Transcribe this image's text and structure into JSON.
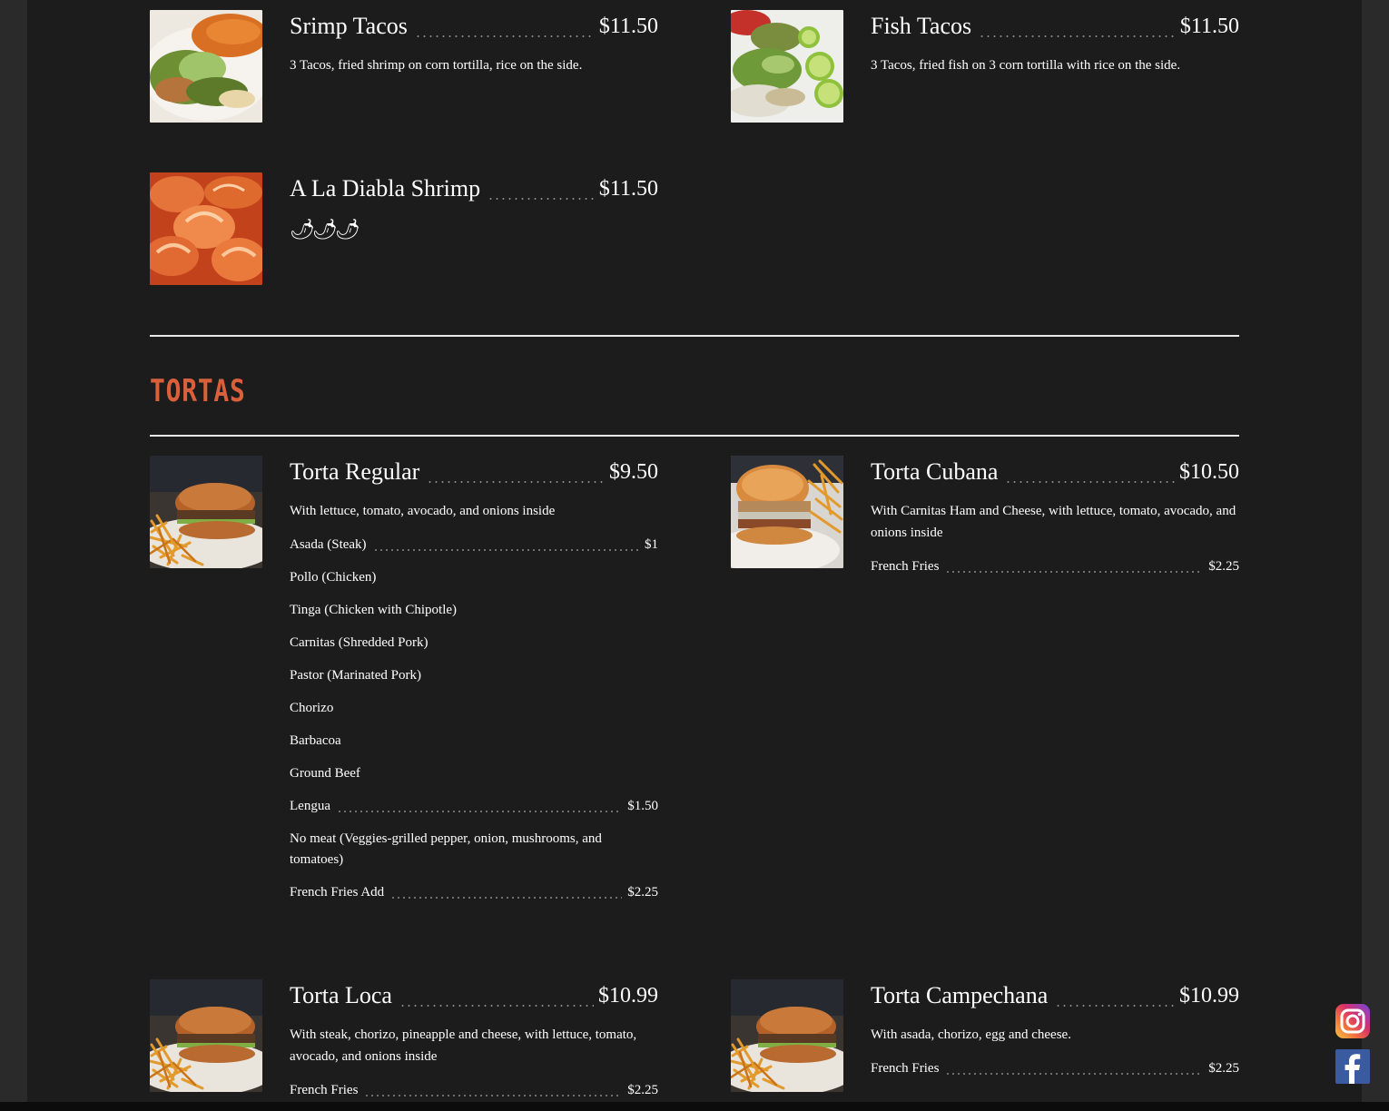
{
  "top_items": [
    {
      "name": "Srimp Tacos",
      "price": "$11.50",
      "description": "3 Tacos, fried shrimp on corn tortilla, rice on the side.",
      "image": "shrimp-tacos-photo"
    },
    {
      "name": "Fish Tacos",
      "price": "$11.50",
      "description": "3 Tacos, fried fish on 3 corn tortilla with rice on the side.",
      "image": "fish-tacos-photo"
    },
    {
      "name": "A La Diabla Shrimp",
      "price": "$11.50",
      "spicy_icons": "🌶🌶🌶",
      "image": "diabla-shrimp-photo"
    }
  ],
  "tortas": {
    "section_title": "TORTAS",
    "items": [
      {
        "name": "Torta Regular",
        "price": "$9.50",
        "description": "With lettuce, tomato, avocado, and onions inside",
        "options": [
          {
            "name": "Asada (Steak)",
            "price": "$1"
          },
          {
            "name": "Pollo (Chicken)",
            "price": ""
          },
          {
            "name": "Tinga (Chicken with Chipotle)",
            "price": ""
          },
          {
            "name": "Carnitas (Shredded Pork)",
            "price": ""
          },
          {
            "name": "Pastor (Marinated Pork)",
            "price": ""
          },
          {
            "name": "Chorizo",
            "price": ""
          },
          {
            "name": "Barbacoa",
            "price": ""
          },
          {
            "name": "Ground Beef",
            "price": ""
          },
          {
            "name": "Lengua",
            "price": "$1.50"
          },
          {
            "name": "No meat (Veggies-grilled pepper, onion, mushrooms, and tomatoes)",
            "price": ""
          },
          {
            "name": "French Fries Add",
            "price": "$2.25"
          }
        ]
      },
      {
        "name": "Torta Cubana",
        "price": "$10.50",
        "description": "With Carnitas Ham and Cheese, with lettuce, tomato, avocado, and onions inside",
        "options": [
          {
            "name": "French Fries",
            "price": "$2.25"
          }
        ]
      },
      {
        "name": "Torta Loca",
        "price": "$10.99",
        "description": "With steak, chorizo, pineapple and cheese, with lettuce, tomato, avocado, and onions inside",
        "options": [
          {
            "name": "French Fries",
            "price": "$2.25"
          }
        ]
      },
      {
        "name": "Torta Campechana",
        "price": "$10.99",
        "description": "With asada, chorizo, egg and cheese.",
        "options": [
          {
            "name": "French Fries",
            "price": "$2.25"
          }
        ]
      }
    ]
  },
  "social": {
    "instagram": "instagram-icon",
    "facebook": "facebook-icon"
  },
  "colors": {
    "background": "#1c1c1c",
    "accent": "#d9603a",
    "text": "#ffffff"
  }
}
